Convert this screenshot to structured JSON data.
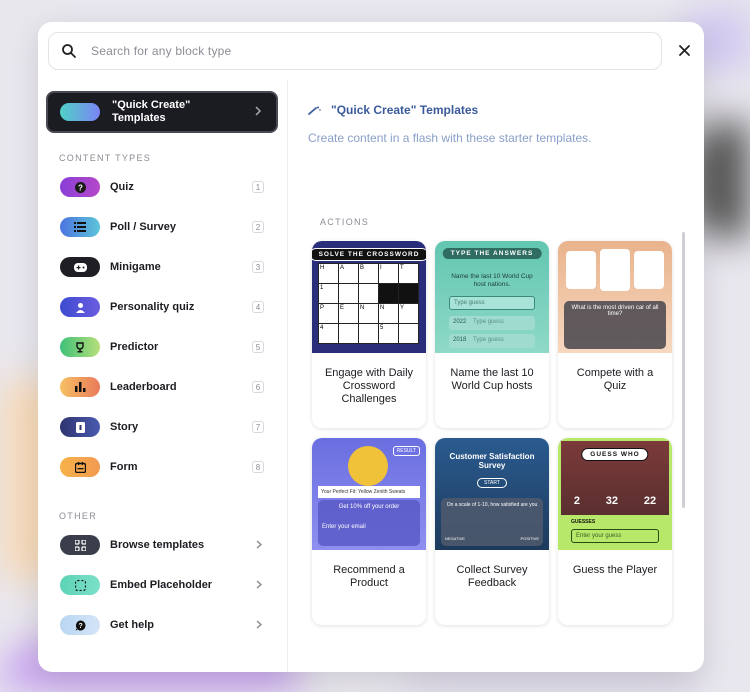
{
  "search": {
    "placeholder": "Search for any block type"
  },
  "close": {
    "icon": "close-icon"
  },
  "quick_create": {
    "label": "\"Quick Create\" Templates"
  },
  "sections": {
    "content_types": "CONTENT TYPES",
    "other": "OTHER"
  },
  "content_types": [
    {
      "label": "Quiz",
      "key": "1",
      "icon": "question-icon",
      "color": "#7b3fd1"
    },
    {
      "label": "Poll / Survey",
      "key": "2",
      "icon": "list-icon",
      "color": "#5b7be6"
    },
    {
      "label": "Minigame",
      "key": "3",
      "icon": "gamepad-icon",
      "color": "#1e1e24"
    },
    {
      "label": "Personality quiz",
      "key": "4",
      "icon": "user-icon",
      "color": "#4b57d6"
    },
    {
      "label": "Predictor",
      "key": "5",
      "icon": "trophy-icon",
      "color": "#55c27a"
    },
    {
      "label": "Leaderboard",
      "key": "6",
      "icon": "bar-chart-icon",
      "color": "#f0a04b"
    },
    {
      "label": "Story",
      "key": "7",
      "icon": "story-icon",
      "color": "#3b3f8a"
    },
    {
      "label": "Form",
      "key": "8",
      "icon": "form-icon",
      "color": "#f3a545"
    }
  ],
  "other": [
    {
      "label": "Browse templates",
      "icon": "grid-icon"
    },
    {
      "label": "Embed Placeholder",
      "icon": "embed-icon"
    },
    {
      "label": "Get help",
      "icon": "help-icon"
    }
  ],
  "main": {
    "title": "\"Quick Create\" Templates",
    "subtitle": "Create content in a flash with these starter templates.",
    "actions_label": "ACTIONS"
  },
  "cards": [
    {
      "caption": "Engage with Daily Crossword Challenges",
      "tag": "SOLVE THE CROSSWORD"
    },
    {
      "caption": "Name the last 10 World Cup hosts",
      "tag": "TYPE THE ANSWERS",
      "question": "Name the last 10 World Cup host nations.",
      "input_placeholder": "Type guess",
      "years": [
        "2022",
        "2018"
      ],
      "row_placeholder": "Type guess"
    },
    {
      "caption": "Compete with a Quiz",
      "question": "What is the most driven car of all time?"
    },
    {
      "caption": "Recommend a Product",
      "badge": "RESULT",
      "product": "Your Perfect Fit: Yellow Zenith Sweats",
      "offer": "Get 10% off your order",
      "email_placeholder": "Enter your email"
    },
    {
      "caption": "Collect Survey Feedback",
      "heading": "Customer Satisfaction Survey",
      "start": "START",
      "question": "On a scale of 1-10, how satisfied are you",
      "scale_low": "NEGATIVE",
      "scale_high": "POSITIVE"
    },
    {
      "caption": "Guess the Player",
      "tag": "GUESS WHO",
      "stats": [
        "2",
        "32",
        "22"
      ],
      "guesses_label": "GUESSES",
      "input_placeholder": "Enter your guess"
    }
  ],
  "crossword": {
    "letters": [
      "H",
      "A",
      "B",
      "I",
      "T",
      "P",
      "E",
      "N",
      "N",
      "Y"
    ],
    "numbers": [
      "1",
      "4",
      "5"
    ]
  }
}
